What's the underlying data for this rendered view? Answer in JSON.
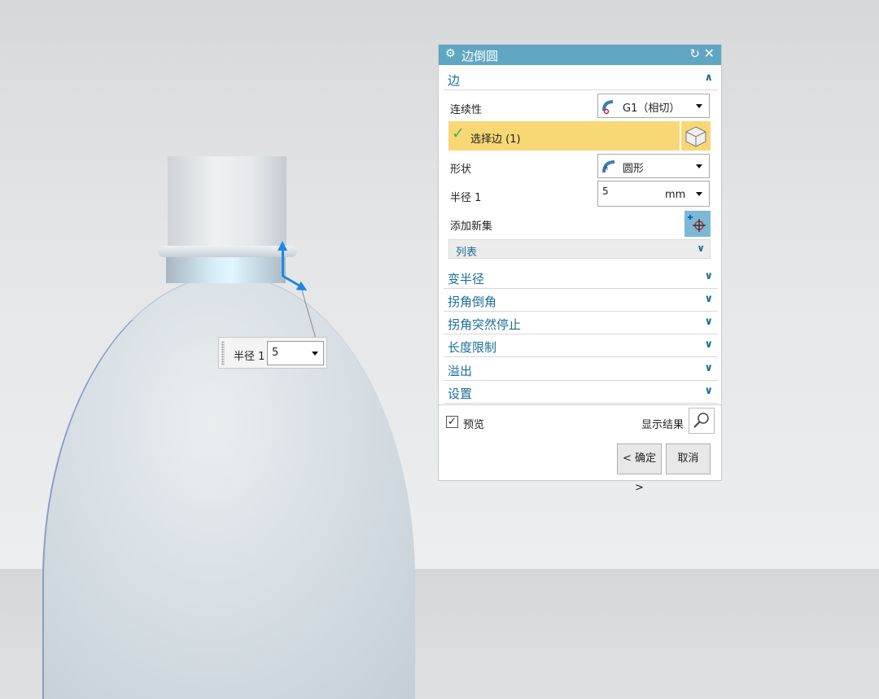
{
  "viewport": {
    "onscreen_input": {
      "label": "半径 1",
      "value": "5"
    }
  },
  "dialog": {
    "title": "边倒圆",
    "title_icon": "gear-icon",
    "reset_icon": "reset-icon",
    "close_icon": "close-icon",
    "sections": {
      "edge": {
        "label": "边",
        "expanded": true
      },
      "variable_radius": {
        "label": "变半径"
      },
      "corner_setback": {
        "label": "拐角倒角"
      },
      "stop_short": {
        "label": "拐角突然停止"
      },
      "length_limit": {
        "label": "长度限制"
      },
      "overflow": {
        "label": "溢出"
      },
      "settings": {
        "label": "设置"
      }
    },
    "continuity": {
      "label": "连续性",
      "value": "G1（相切）"
    },
    "select_edge": {
      "label": "选择边 (1)"
    },
    "shape": {
      "label": "形状",
      "value": "圆形"
    },
    "radius": {
      "label": "半径 1",
      "value": "5",
      "unit": "mm"
    },
    "add_new_set": {
      "label": "添加新集"
    },
    "list": {
      "label": "列表"
    },
    "preview": {
      "label": "预览",
      "checked": true
    },
    "show_result": {
      "label": "显示结果"
    },
    "ok_button": "< 确定 >",
    "cancel_button": "取消"
  },
  "colors": {
    "title_bar": "#5fa6c2",
    "section_text": "#1a6f96",
    "selection_highlight": "#f8d775",
    "handle": "#1e88e5"
  }
}
